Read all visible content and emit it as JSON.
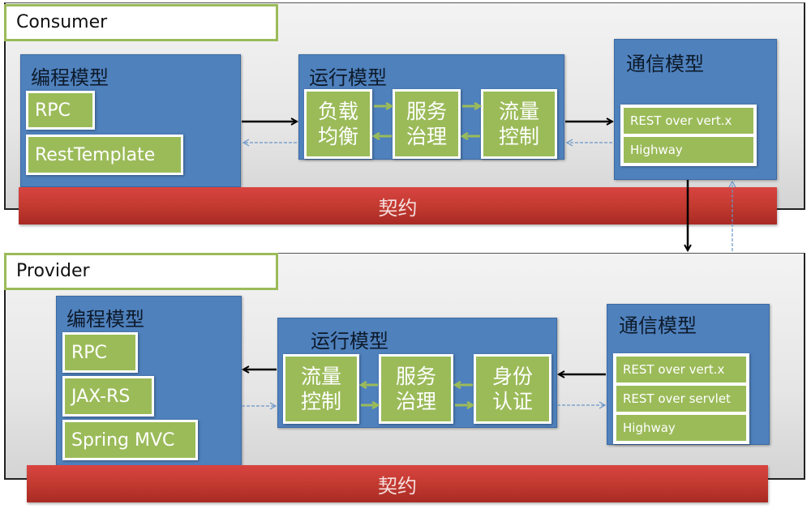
{
  "consumer": {
    "title": "Consumer",
    "programming_model": {
      "title": "编程模型",
      "items": [
        "RPC",
        "RestTemplate"
      ]
    },
    "runtime_model": {
      "title": "运行模型",
      "modules": [
        "负载\n均衡",
        "服务\n治理",
        "流量\n控制"
      ]
    },
    "communication_model": {
      "title": "通信模型",
      "transports": [
        "REST over vert.x",
        "Highway"
      ]
    },
    "contract": "契约"
  },
  "provider": {
    "title": "Provider",
    "programming_model": {
      "title": "编程模型",
      "items": [
        "RPC",
        "JAX-RS",
        "Spring MVC"
      ]
    },
    "runtime_model": {
      "title": "运行模型",
      "modules": [
        "流量\n控制",
        "服务\n治理",
        "身份\n认证"
      ]
    },
    "communication_model": {
      "title": "通信模型",
      "transports": [
        "REST over vert.x",
        "REST over servlet",
        "Highway"
      ]
    },
    "contract": "契约"
  },
  "colors": {
    "panel_title_border": "#9bbb59",
    "model_box": "#4f81bd",
    "component": "#9bbb59",
    "contract_bar": "#c0392f",
    "request_arrow": "#000000",
    "response_arrow": "#4f81bd"
  }
}
